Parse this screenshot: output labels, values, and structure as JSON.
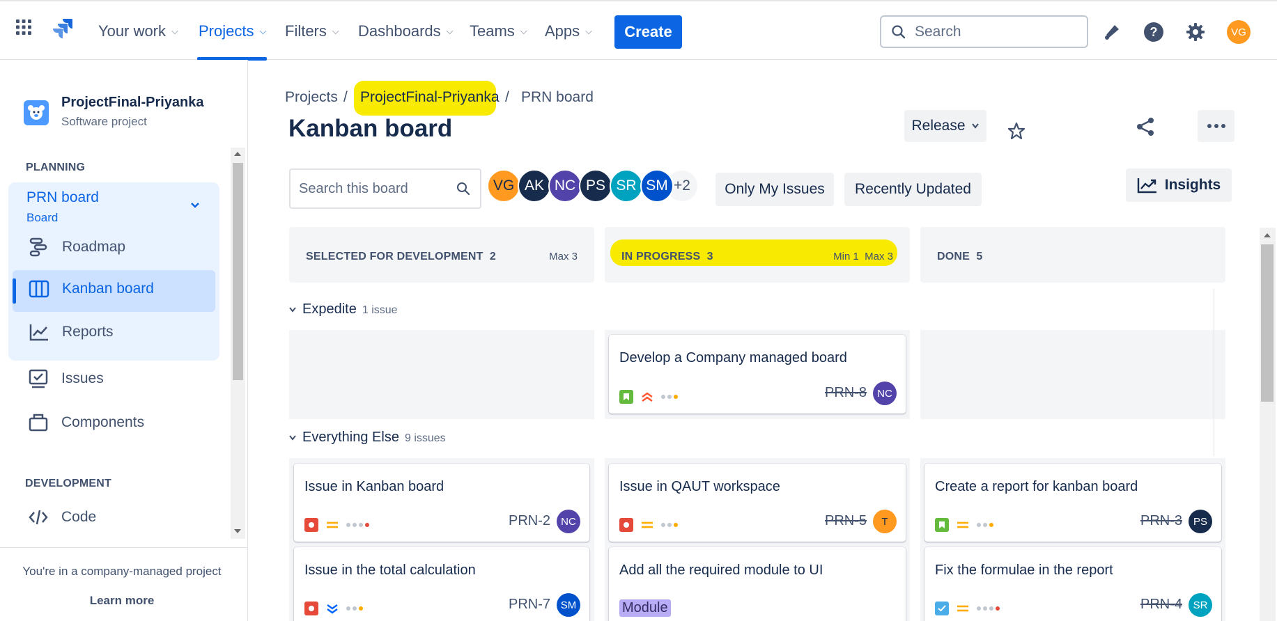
{
  "topbar": {
    "nav": [
      {
        "label": "Your work"
      },
      {
        "label": "Projects"
      },
      {
        "label": "Filters"
      },
      {
        "label": "Dashboards"
      },
      {
        "label": "Teams"
      },
      {
        "label": "Apps"
      }
    ],
    "create_label": "Create",
    "search_placeholder": "Search",
    "user_initials": "VG"
  },
  "sidebar": {
    "project_name": "ProjectFinal-Priyanka",
    "project_type": "Software project",
    "planning_label": "PLANNING",
    "board_name": "PRN board",
    "board_sub": "Board",
    "items": [
      {
        "label": "Roadmap"
      },
      {
        "label": "Kanban board"
      },
      {
        "label": "Reports"
      },
      {
        "label": "Issues"
      },
      {
        "label": "Components"
      }
    ],
    "development_label": "DEVELOPMENT",
    "dev_items": [
      {
        "label": "Code"
      }
    ],
    "footer_text": "You're in a company-managed project",
    "learn_more": "Learn more"
  },
  "main": {
    "breadcrumb": [
      "Projects",
      "ProjectFinal-Priyanka",
      "PRN board"
    ],
    "separator": "/",
    "title": "Kanban board",
    "release_label": "Release",
    "board_search_placeholder": "Search this board",
    "avatars": [
      {
        "initials": "VG",
        "color": "#ff991f"
      },
      {
        "initials": "AK",
        "color": "#172b4d"
      },
      {
        "initials": "NC",
        "color": "#5243aa"
      },
      {
        "initials": "PS",
        "color": "#172b4d"
      },
      {
        "initials": "SR",
        "color": "#00a3bf"
      },
      {
        "initials": "SM",
        "color": "#0052cc"
      }
    ],
    "more_avatars": "+2",
    "filters": [
      "Only My Issues",
      "Recently Updated"
    ],
    "insights_label": "Insights",
    "columns": [
      {
        "name": "SELECTED FOR DEVELOPMENT",
        "count": "2",
        "limit": "Max 3"
      },
      {
        "name": "IN PROGRESS",
        "count": "3",
        "limit": "Min 1  Max 3"
      },
      {
        "name": "DONE",
        "count": "5",
        "limit": ""
      }
    ],
    "swimlanes": [
      {
        "name": "Expedite",
        "count": "1 issue"
      },
      {
        "name": "Everything Else",
        "count": "9 issues"
      }
    ],
    "cards": {
      "prn8": {
        "title": "Develop a Company managed board",
        "key": "PRN-8",
        "assignee": "NC"
      },
      "prn2": {
        "title": "Issue in Kanban board",
        "key": "PRN-2",
        "assignee": "NC"
      },
      "prn5": {
        "title": "Issue in QAUT workspace",
        "key": "PRN-5",
        "assignee": "T"
      },
      "prn3": {
        "title": "Create a report for kanban board",
        "key": "PRN-3",
        "assignee": "PS"
      },
      "prn7": {
        "title": "Issue in the total calculation",
        "key": "PRN-7",
        "assignee": "SM"
      },
      "ui": {
        "title": "Add all the required module to UI",
        "label": "Module"
      },
      "prn4": {
        "title": "Fix the formulae in the report",
        "key": "PRN-4",
        "assignee": "SR"
      }
    }
  },
  "colors": {
    "accent": "#0c66e4",
    "highlight": "#f8ea00",
    "bug": "#e5493a",
    "story": "#63ba3c",
    "task": "#4bade8"
  }
}
